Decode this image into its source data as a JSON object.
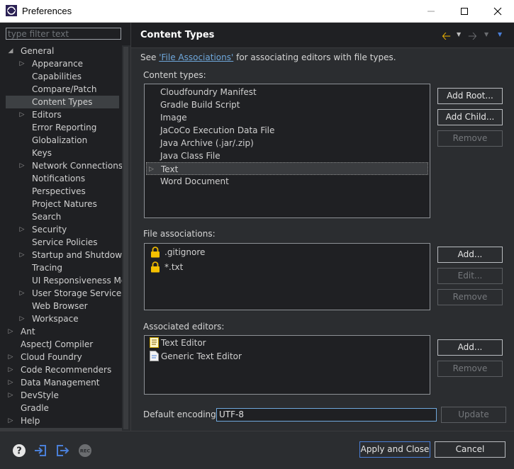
{
  "window": {
    "title": "Preferences"
  },
  "filter": {
    "placeholder": "type filter text"
  },
  "tree": [
    {
      "label": "General",
      "level": 0,
      "twisty": "expanded"
    },
    {
      "label": "Appearance",
      "level": 1,
      "twisty": "collapsed"
    },
    {
      "label": "Capabilities",
      "level": 1,
      "twisty": "none"
    },
    {
      "label": "Compare/Patch",
      "level": 1,
      "twisty": "none"
    },
    {
      "label": "Content Types",
      "level": 1,
      "twisty": "none",
      "selected": true
    },
    {
      "label": "Editors",
      "level": 1,
      "twisty": "collapsed"
    },
    {
      "label": "Error Reporting",
      "level": 1,
      "twisty": "none"
    },
    {
      "label": "Globalization",
      "level": 1,
      "twisty": "none"
    },
    {
      "label": "Keys",
      "level": 1,
      "twisty": "none"
    },
    {
      "label": "Network Connections",
      "level": 1,
      "twisty": "collapsed"
    },
    {
      "label": "Notifications",
      "level": 1,
      "twisty": "none"
    },
    {
      "label": "Perspectives",
      "level": 1,
      "twisty": "none"
    },
    {
      "label": "Project Natures",
      "level": 1,
      "twisty": "none"
    },
    {
      "label": "Search",
      "level": 1,
      "twisty": "none"
    },
    {
      "label": "Security",
      "level": 1,
      "twisty": "collapsed"
    },
    {
      "label": "Service Policies",
      "level": 1,
      "twisty": "none"
    },
    {
      "label": "Startup and Shutdown",
      "level": 1,
      "twisty": "collapsed"
    },
    {
      "label": "Tracing",
      "level": 1,
      "twisty": "none"
    },
    {
      "label": "UI Responsiveness Mor",
      "level": 1,
      "twisty": "none"
    },
    {
      "label": "User Storage Service",
      "level": 1,
      "twisty": "collapsed"
    },
    {
      "label": "Web Browser",
      "level": 1,
      "twisty": "none"
    },
    {
      "label": "Workspace",
      "level": 1,
      "twisty": "collapsed"
    },
    {
      "label": "Ant",
      "level": 0,
      "twisty": "collapsed"
    },
    {
      "label": "AspectJ Compiler",
      "level": 0,
      "twisty": "none"
    },
    {
      "label": "Cloud Foundry",
      "level": 0,
      "twisty": "collapsed"
    },
    {
      "label": "Code Recommenders",
      "level": 0,
      "twisty": "collapsed"
    },
    {
      "label": "Data Management",
      "level": 0,
      "twisty": "collapsed"
    },
    {
      "label": "DevStyle",
      "level": 0,
      "twisty": "collapsed"
    },
    {
      "label": "Gradle",
      "level": 0,
      "twisty": "none"
    },
    {
      "label": "Help",
      "level": 0,
      "twisty": "collapsed"
    }
  ],
  "page": {
    "title": "Content Types",
    "see_prefix": "See ",
    "see_link": "'File Associations'",
    "see_suffix": " for associating editors with file types.",
    "content_types_label": "Content types:",
    "content_types": [
      "Cloudfoundry Manifest",
      "Gradle Build Script",
      "Image",
      "JaCoCo Execution Data File",
      "Java Archive (.jar/.zip)",
      "Java Class File",
      "Text",
      "Word Document"
    ],
    "content_types_selected": "Text",
    "file_assoc_label": "File associations:",
    "file_assocs": [
      ".gitignore",
      "*.txt"
    ],
    "assoc_editors_label": "Associated editors:",
    "editors": [
      "Text Editor",
      "Generic Text Editor"
    ],
    "encoding_label": "Default encoding:",
    "encoding_value": "UTF-8"
  },
  "buttons": {
    "add_root": "Add Root...",
    "add_child": "Add Child...",
    "remove_ct": "Remove",
    "add_fa": "Add...",
    "edit_fa": "Edit...",
    "remove_fa": "Remove",
    "add_ed": "Add...",
    "remove_ed": "Remove",
    "update": "Update",
    "apply_close": "Apply and Close",
    "cancel": "Cancel"
  },
  "footer_icons": [
    "help-icon",
    "import-icon",
    "export-icon",
    "record-icon"
  ],
  "footer": {
    "rec_label": "REC"
  },
  "colors": {
    "accent_link": "#6fa8dc",
    "back_arrow": "#f0b400",
    "dropdown": "#4a7fd8"
  }
}
